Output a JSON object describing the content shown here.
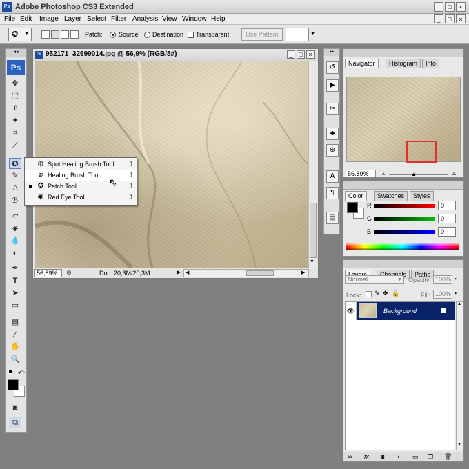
{
  "window": {
    "title": "Adobe Photoshop CS3 Extended",
    "logo": "Ps"
  },
  "menu": [
    "File",
    "Edit",
    "Image",
    "Layer",
    "Select",
    "Filter",
    "Analysis",
    "View",
    "Window",
    "Help"
  ],
  "options": {
    "patch_label": "Patch:",
    "source_label": "Source",
    "destination_label": "Destination",
    "transparent_label": "Transparent",
    "use_pattern_label": "Use Pattern",
    "selected_mode": "Source"
  },
  "toolbox": {
    "logo": "Ps"
  },
  "document": {
    "title": "952171_32699014.jpg @ 56,9% (RGB/8#)",
    "zoom": "56,89%",
    "doc_size": "Doc: 20,3M/20,3M"
  },
  "flyout": {
    "items": [
      {
        "label": "Spot Healing Brush Tool",
        "key": "J",
        "icon": "spot-healing-icon"
      },
      {
        "label": "Healing Brush Tool",
        "key": "J",
        "icon": "bandage-icon"
      },
      {
        "label": "Patch Tool",
        "key": "J",
        "icon": "patch-icon"
      },
      {
        "label": "Red Eye Tool",
        "key": "J",
        "icon": "red-eye-icon"
      }
    ],
    "hovered_index": 1,
    "active_index": 2
  },
  "navigator": {
    "tabs": [
      "Navigator",
      "Histogram",
      "Info"
    ],
    "zoom": "56.89%"
  },
  "color": {
    "tabs": [
      "Color",
      "Swatches",
      "Styles"
    ],
    "channels": [
      {
        "label": "R",
        "value": "0",
        "color": "#ff0000"
      },
      {
        "label": "G",
        "value": "0",
        "color": "#00c000"
      },
      {
        "label": "B",
        "value": "0",
        "color": "#0000ff"
      }
    ]
  },
  "layers": {
    "tabs": [
      "Layers",
      "Channels",
      "Paths"
    ],
    "blend_mode": "Normal",
    "opacity_label": "Opacity:",
    "opacity_value": "100%",
    "lock_label": "Lock:",
    "fill_label": "Fill:",
    "fill_value": "100%",
    "layer_name": "Background"
  },
  "colors": {
    "accent_blue": "#0a246a",
    "title_bg": "#d6d6d6"
  }
}
